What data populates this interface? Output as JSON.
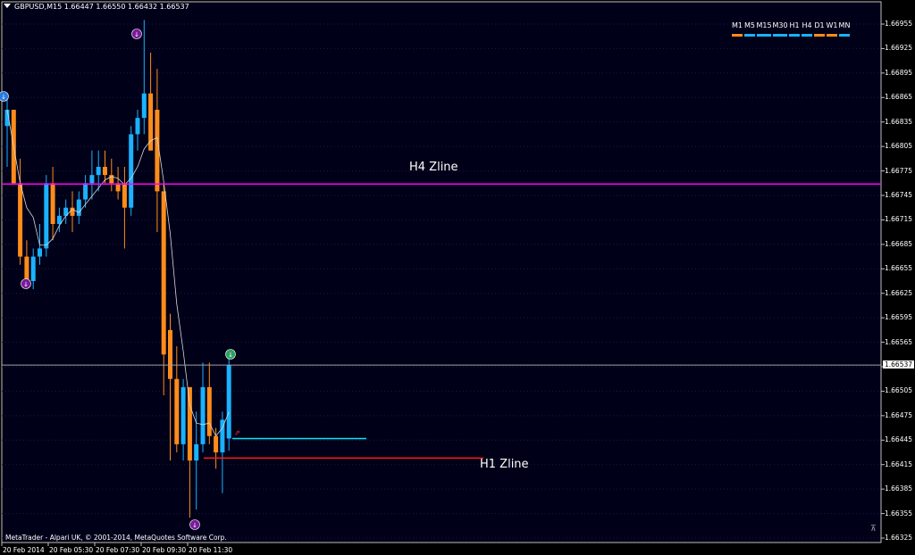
{
  "header": {
    "symbol_info": "GBPUSD,M15  1.66447 1.66550 1.66432 1.66537"
  },
  "copyright": "MetaTrader - Alpari UK, © 2001-2014, MetaQuotes Software Corp.",
  "timeframes": [
    {
      "label": "M1",
      "color": "#ff8c1a"
    },
    {
      "label": "M5",
      "color": "#1ab2ff"
    },
    {
      "label": "M15",
      "color": "#1ab2ff"
    },
    {
      "label": "M30",
      "color": "#1ab2ff"
    },
    {
      "label": "H1",
      "color": "#1ab2ff"
    },
    {
      "label": "H4",
      "color": "#1ab2ff"
    },
    {
      "label": "D1",
      "color": "#ff8c1a"
    },
    {
      "label": "W1",
      "color": "#ff8c1a"
    },
    {
      "label": "MN",
      "color": "#1ab2ff"
    }
  ],
  "lines": {
    "h4_label": "H4 Zline",
    "h1_label": "H1 Zline",
    "h4_price": 1.66759,
    "h1_price": 1.66423,
    "cyan_price": 1.66447,
    "current_price": 1.66537
  },
  "colors": {
    "bull": "#1ab2ff",
    "bear": "#ff8c1a",
    "bg": "#000018",
    "h4": "#ff00ff",
    "h1": "#ff1a1a",
    "cyan": "#00e5ff"
  },
  "chart_data": {
    "type": "candlestick",
    "y_ticks": [
      "1.66955",
      "1.66925",
      "1.66895",
      "1.66865",
      "1.66835",
      "1.66805",
      "1.66775",
      "1.66745",
      "1.66715",
      "1.66685",
      "1.66655",
      "1.66625",
      "1.66595",
      "1.66565",
      "1.66535",
      "1.66505",
      "1.66475",
      "1.66445",
      "1.66415",
      "1.66385",
      "1.66355",
      "1.66325"
    ],
    "current_price_label": "1.66537",
    "x_ticks": [
      "20 Feb 2014",
      "20 Feb 05:30",
      "20 Feb 07:30",
      "20 Feb 09:30",
      "20 Feb 11:30"
    ],
    "ylim": [
      1.66315,
      1.66975
    ],
    "candles": [
      {
        "o": 1.6683,
        "h": 1.6687,
        "l": 1.6678,
        "c": 1.6685
      },
      {
        "o": 1.6685,
        "h": 1.6685,
        "l": 1.6676,
        "c": 1.6676
      },
      {
        "o": 1.6676,
        "h": 1.6679,
        "l": 1.6666,
        "c": 1.6667
      },
      {
        "o": 1.6667,
        "h": 1.6669,
        "l": 1.6663,
        "c": 1.6664
      },
      {
        "o": 1.6664,
        "h": 1.6668,
        "l": 1.6663,
        "c": 1.6667
      },
      {
        "o": 1.6667,
        "h": 1.6671,
        "l": 1.6666,
        "c": 1.6668
      },
      {
        "o": 1.6668,
        "h": 1.6677,
        "l": 1.6667,
        "c": 1.6676
      },
      {
        "o": 1.6676,
        "h": 1.6678,
        "l": 1.6669,
        "c": 1.6671
      },
      {
        "o": 1.6671,
        "h": 1.6673,
        "l": 1.667,
        "c": 1.6672
      },
      {
        "o": 1.6672,
        "h": 1.6674,
        "l": 1.6671,
        "c": 1.6673
      },
      {
        "o": 1.6673,
        "h": 1.6675,
        "l": 1.667,
        "c": 1.6672
      },
      {
        "o": 1.6672,
        "h": 1.6675,
        "l": 1.6671,
        "c": 1.6674
      },
      {
        "o": 1.6674,
        "h": 1.6677,
        "l": 1.6673,
        "c": 1.6676
      },
      {
        "o": 1.6676,
        "h": 1.668,
        "l": 1.6674,
        "c": 1.6677
      },
      {
        "o": 1.6677,
        "h": 1.668,
        "l": 1.6675,
        "c": 1.6678
      },
      {
        "o": 1.6678,
        "h": 1.668,
        "l": 1.6676,
        "c": 1.6677
      },
      {
        "o": 1.6677,
        "h": 1.6679,
        "l": 1.6675,
        "c": 1.6676
      },
      {
        "o": 1.6676,
        "h": 1.6678,
        "l": 1.6674,
        "c": 1.6675
      },
      {
        "o": 1.6676,
        "h": 1.6678,
        "l": 1.6668,
        "c": 1.6673
      },
      {
        "o": 1.6673,
        "h": 1.6683,
        "l": 1.6672,
        "c": 1.6682
      },
      {
        "o": 1.6682,
        "h": 1.6685,
        "l": 1.668,
        "c": 1.6684
      },
      {
        "o": 1.6684,
        "h": 1.6696,
        "l": 1.6682,
        "c": 1.6687
      },
      {
        "o": 1.6687,
        "h": 1.6692,
        "l": 1.6682,
        "c": 1.668
      },
      {
        "o": 1.6685,
        "h": 1.669,
        "l": 1.667,
        "c": 1.6675
      },
      {
        "o": 1.6675,
        "h": 1.6676,
        "l": 1.665,
        "c": 1.6655
      },
      {
        "o": 1.6658,
        "h": 1.666,
        "l": 1.6642,
        "c": 1.6652
      },
      {
        "o": 1.6652,
        "h": 1.6656,
        "l": 1.6643,
        "c": 1.6644
      },
      {
        "o": 1.6644,
        "h": 1.6652,
        "l": 1.6642,
        "c": 1.6651
      },
      {
        "o": 1.6651,
        "h": 1.6651,
        "l": 1.6635,
        "c": 1.6642
      },
      {
        "o": 1.6642,
        "h": 1.6648,
        "l": 1.6636,
        "c": 1.6644
      },
      {
        "o": 1.6644,
        "h": 1.6654,
        "l": 1.6643,
        "c": 1.6651
      },
      {
        "o": 1.6651,
        "h": 1.6654,
        "l": 1.6644,
        "c": 1.6645
      },
      {
        "o": 1.6645,
        "h": 1.6646,
        "l": 1.6641,
        "c": 1.6643
      },
      {
        "o": 1.6643,
        "h": 1.6648,
        "l": 1.6638,
        "c": 1.6647
      },
      {
        "o": 1.66447,
        "h": 1.6655,
        "l": 1.66432,
        "c": 1.66537
      }
    ]
  }
}
